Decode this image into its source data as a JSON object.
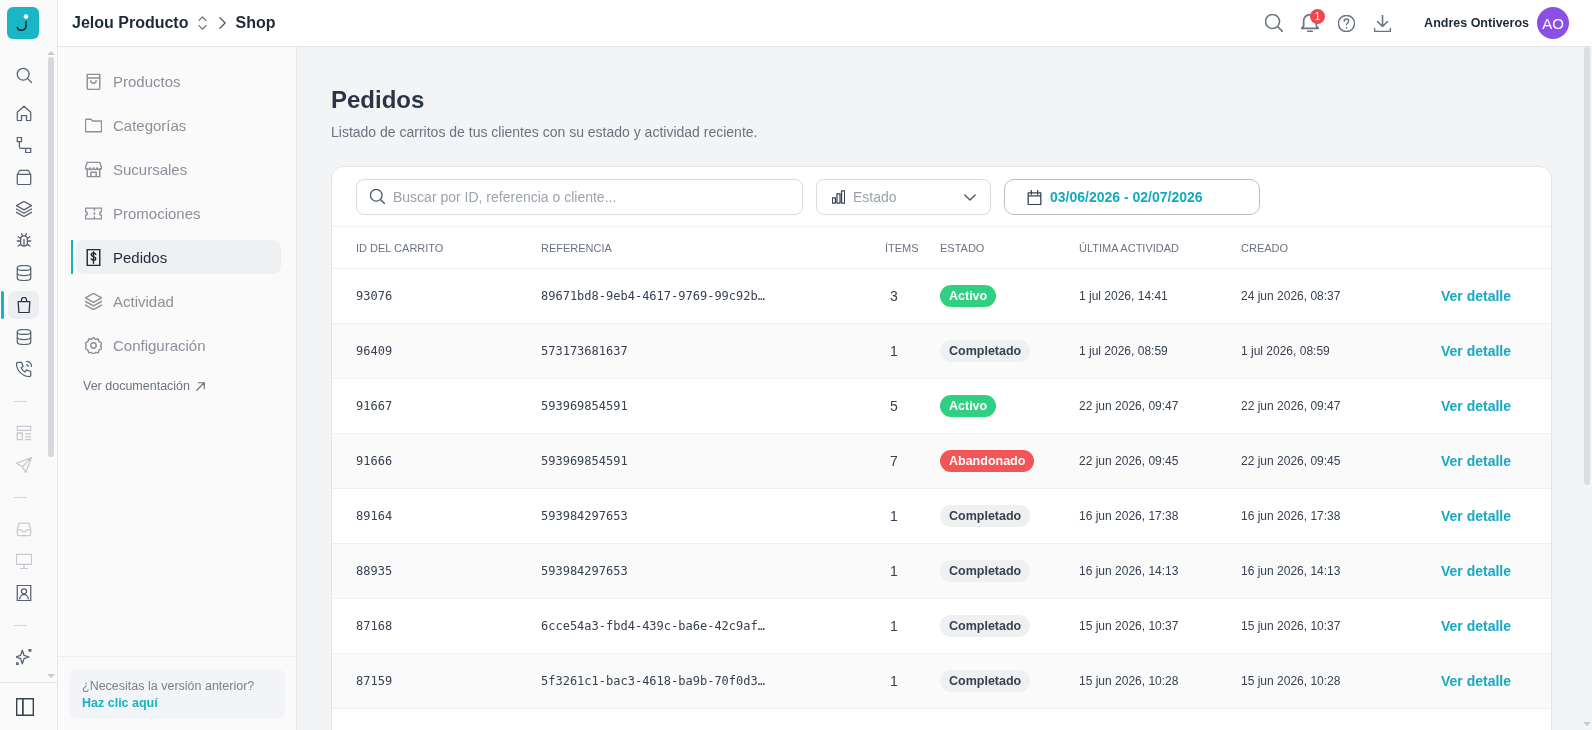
{
  "rail": {
    "groups": [
      {
        "items": [
          {
            "selected": false,
            "disabled": false
          },
          {
            "selected": false,
            "disabled": false
          },
          {
            "selected": false,
            "disabled": false
          },
          {
            "selected": false,
            "disabled": false
          },
          {
            "selected": false,
            "disabled": false
          },
          {
            "selected": false,
            "disabled": false
          },
          {
            "selected": false,
            "disabled": false
          },
          {
            "selected": true,
            "disabled": false
          },
          {
            "selected": false,
            "disabled": false
          },
          {
            "selected": false,
            "disabled": false
          }
        ]
      },
      {
        "items": [
          {
            "selected": false,
            "disabled": true
          },
          {
            "selected": false,
            "disabled": true
          }
        ]
      },
      {
        "items": [
          {
            "selected": false,
            "disabled": true
          },
          {
            "selected": false,
            "disabled": true
          },
          {
            "selected": false,
            "disabled": false
          }
        ]
      },
      {
        "items": [
          {
            "selected": false,
            "disabled": false
          }
        ]
      }
    ]
  },
  "topbar": {
    "breadcrumb": {
      "workspace": "Jelou Producto",
      "page": "Shop"
    },
    "notifications": {
      "count": "1"
    },
    "user": {
      "name": "Andres Ontiveros",
      "initials": "AO"
    }
  },
  "sidebar": {
    "items": [
      {
        "label": "Productos",
        "selected": false
      },
      {
        "label": "Categorías",
        "selected": false
      },
      {
        "label": "Sucursales",
        "selected": false
      },
      {
        "label": "Promociones",
        "selected": false
      },
      {
        "label": "Pedidos",
        "selected": true
      },
      {
        "label": "Actividad",
        "selected": false
      },
      {
        "label": "Configuración",
        "selected": false
      }
    ],
    "doc_link": "Ver documentación",
    "legacy": {
      "question": "¿Necesitas la versión anterior?",
      "link": "Haz clic aquí"
    }
  },
  "page": {
    "title": "Pedidos",
    "subtitle": "Listado de carritos de tus clientes con su estado y actividad reciente."
  },
  "filters": {
    "search": {
      "placeholder": "Buscar por ID, referencia o cliente..."
    },
    "status": {
      "placeholder": "Estado"
    },
    "date_range": "03/06/2026 - 02/07/2026"
  },
  "table": {
    "columns": [
      "ID DEL CARRITO",
      "REFERENCIA",
      "ÍTEMS",
      "ESTADO",
      "ÚLTIMA ACTIVIDAD",
      "CREADO"
    ],
    "rows": [
      {
        "id": "93076",
        "reference": "89671bd8-9eb4-4617-9769-99c92b…",
        "items": "3",
        "status": {
          "label": "Activo",
          "kind": "active"
        },
        "last_activity": "1 jul 2026, 14:41",
        "created": "24 jun 2026, 08:37",
        "action": "Ver detalle"
      },
      {
        "id": "96409",
        "reference": "573173681637",
        "items": "1",
        "status": {
          "label": "Completado",
          "kind": "completed"
        },
        "last_activity": "1 jul 2026, 08:59",
        "created": "1 jul 2026, 08:59",
        "action": "Ver detalle"
      },
      {
        "id": "91667",
        "reference": "593969854591",
        "items": "5",
        "status": {
          "label": "Activo",
          "kind": "active"
        },
        "last_activity": "22 jun 2026, 09:47",
        "created": "22 jun 2026, 09:47",
        "action": "Ver detalle"
      },
      {
        "id": "91666",
        "reference": "593969854591",
        "items": "7",
        "status": {
          "label": "Abandonado",
          "kind": "abandoned"
        },
        "last_activity": "22 jun 2026, 09:45",
        "created": "22 jun 2026, 09:45",
        "action": "Ver detalle"
      },
      {
        "id": "89164",
        "reference": "593984297653",
        "items": "1",
        "status": {
          "label": "Completado",
          "kind": "completed"
        },
        "last_activity": "16 jun 2026, 17:38",
        "created": "16 jun 2026, 17:38",
        "action": "Ver detalle"
      },
      {
        "id": "88935",
        "reference": "593984297653",
        "items": "1",
        "status": {
          "label": "Completado",
          "kind": "completed"
        },
        "last_activity": "16 jun 2026, 14:13",
        "created": "16 jun 2026, 14:13",
        "action": "Ver detalle"
      },
      {
        "id": "87168",
        "reference": "6cce54a3-fbd4-439c-ba6e-42c9af…",
        "items": "1",
        "status": {
          "label": "Completado",
          "kind": "completed"
        },
        "last_activity": "15 jun 2026, 10:37",
        "created": "15 jun 2026, 10:37",
        "action": "Ver detalle"
      },
      {
        "id": "87159",
        "reference": "5f3261c1-bac3-4618-ba9b-70f0d3…",
        "items": "1",
        "status": {
          "label": "Completado",
          "kind": "completed"
        },
        "last_activity": "15 jun 2026, 10:28",
        "created": "15 jun 2026, 10:28",
        "action": "Ver detalle"
      }
    ]
  }
}
